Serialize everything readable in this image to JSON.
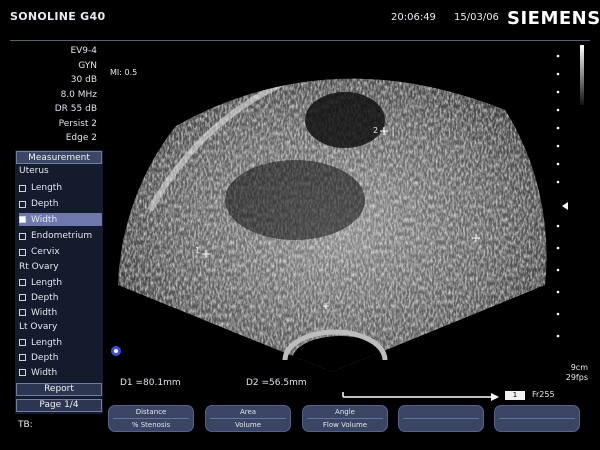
{
  "header": {
    "brand": "SONOLINE G40",
    "time": "20:06:49",
    "date": "15/03/06",
    "logo": "SIEMENS"
  },
  "params": [
    "EV9-4",
    "GYN",
    "30 dB",
    "8.0 MHz",
    "DR 55 dB",
    "Persist 2",
    "Edge 2"
  ],
  "image_overlay": {
    "mi": "MI: 0.5",
    "markers": [
      "1",
      "2"
    ]
  },
  "measurement_panel": {
    "title": "Measurement",
    "groups": [
      {
        "name": "Uterus",
        "items": [
          "Length",
          "Depth",
          "Width",
          "Endometrium",
          "Cervix"
        ]
      },
      {
        "name": "Rt Ovary",
        "items": [
          "Length",
          "Depth",
          "Width"
        ]
      },
      {
        "name": "Lt Ovary",
        "items": [
          "Length",
          "Depth",
          "Width"
        ]
      }
    ],
    "selected": "Width",
    "report": "Report",
    "page": "Page 1/4"
  },
  "tb_label": "TB:",
  "measurements": {
    "d1": "D1 =80.1mm",
    "d2": "D2 =56.5mm"
  },
  "status": {
    "depth": "9cm",
    "fps": "29fps",
    "frame_badge": "1",
    "frame": "Fr255"
  },
  "softkeys": [
    {
      "top": "Distance",
      "bottom": "% Stenosis"
    },
    {
      "top": "Area",
      "bottom": "Volume"
    },
    {
      "top": "Angle",
      "bottom": "Flow Volume"
    },
    {
      "top": "",
      "bottom": ""
    },
    {
      "top": "",
      "bottom": ""
    }
  ]
}
